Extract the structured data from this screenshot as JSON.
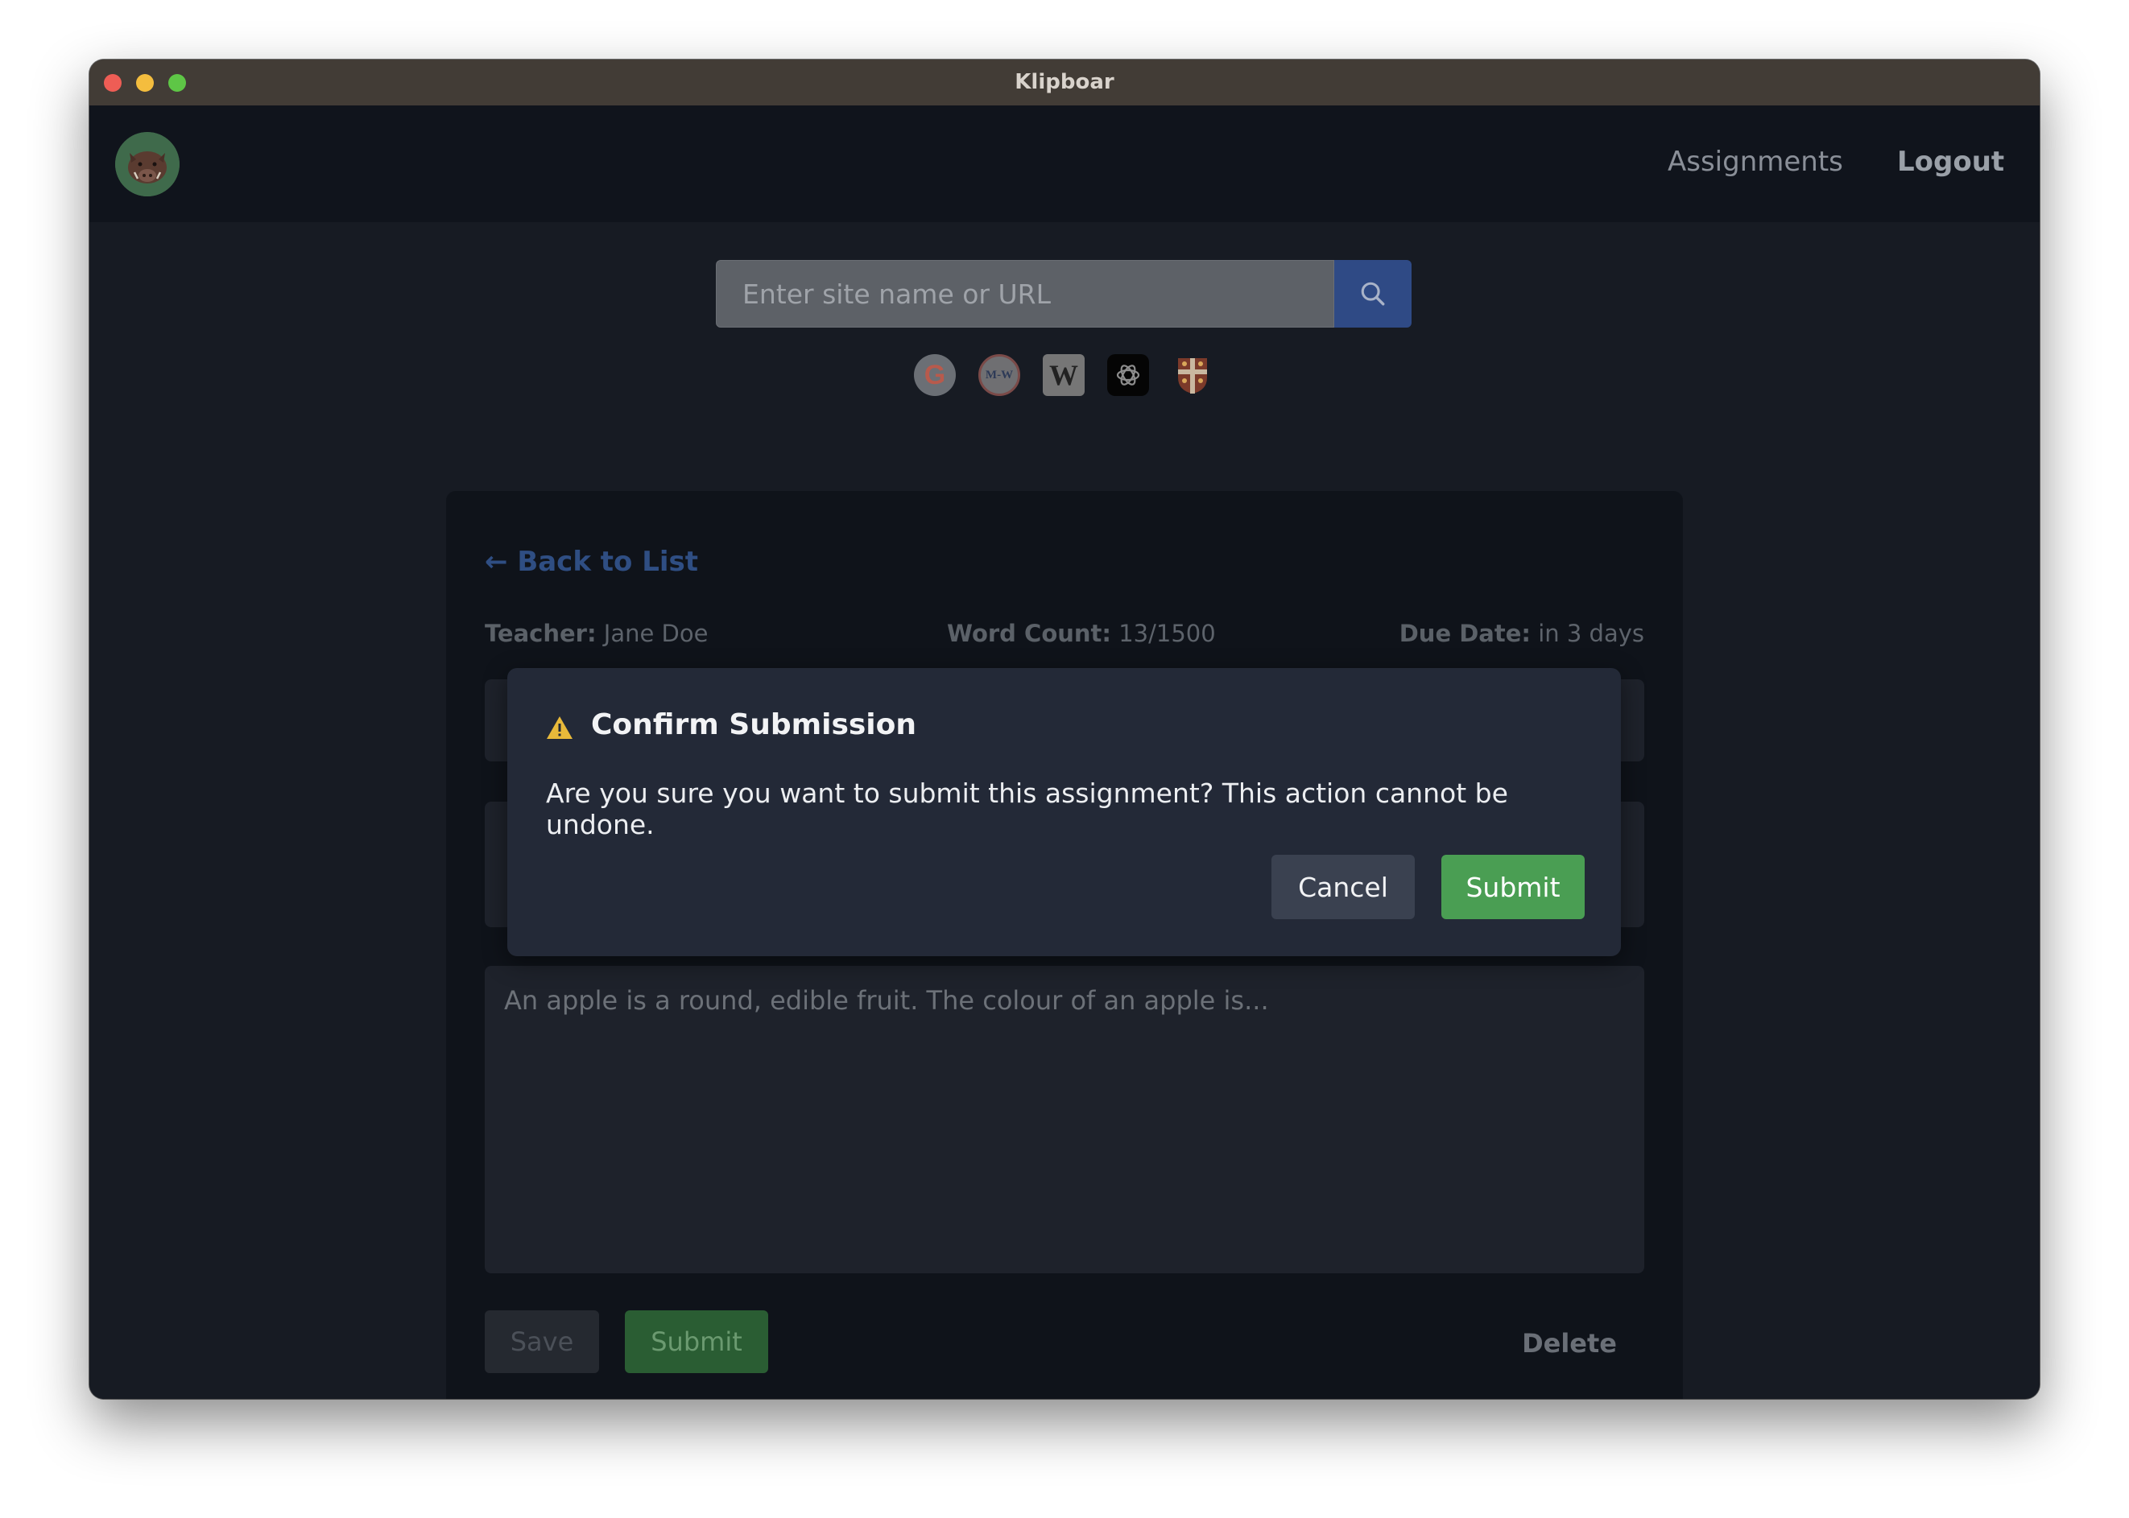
{
  "window": {
    "title": "Klipboar"
  },
  "nav": {
    "assignments": "Assignments",
    "logout": "Logout"
  },
  "search": {
    "placeholder": "Enter site name or URL"
  },
  "shortcuts": [
    {
      "icon": "google-icon",
      "glyph": "G"
    },
    {
      "icon": "merriam-webster-icon",
      "glyph": "M-W"
    },
    {
      "icon": "wikipedia-icon",
      "glyph": "W"
    },
    {
      "icon": "chatgpt-icon"
    },
    {
      "icon": "cambridge-icon"
    }
  ],
  "assignment": {
    "back_label": "← Back to List",
    "teacher_label": "Teacher:",
    "teacher_value": "Jane Doe",
    "word_count_label": "Word Count:",
    "word_count_value": "13/1500",
    "due_label": "Due Date:",
    "due_value": "in 3 days",
    "essay_text": "An apple is a round, edible fruit. The colour of an apple is...",
    "save_label": "Save",
    "submit_label": "Submit",
    "delete_label": "Delete"
  },
  "dialog": {
    "title": "Confirm Submission",
    "message": "Are you sure you want to submit this assignment? This action cannot be undone.",
    "cancel_label": "Cancel",
    "submit_label": "Submit"
  },
  "colors": {
    "accent_blue": "#2f4a85",
    "submit_green": "#4a9e53",
    "warning_yellow": "#e8b93a"
  }
}
